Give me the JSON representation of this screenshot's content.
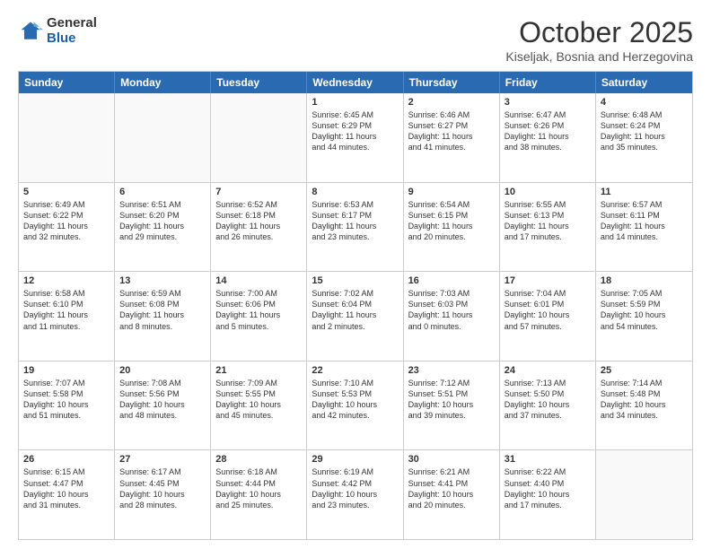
{
  "header": {
    "logo_general": "General",
    "logo_blue": "Blue",
    "month_title": "October 2025",
    "location": "Kiseljak, Bosnia and Herzegovina"
  },
  "calendar": {
    "days": [
      "Sunday",
      "Monday",
      "Tuesday",
      "Wednesday",
      "Thursday",
      "Friday",
      "Saturday"
    ],
    "rows": [
      [
        {
          "day": "",
          "info": ""
        },
        {
          "day": "",
          "info": ""
        },
        {
          "day": "",
          "info": ""
        },
        {
          "day": "1",
          "info": "Sunrise: 6:45 AM\nSunset: 6:29 PM\nDaylight: 11 hours\nand 44 minutes."
        },
        {
          "day": "2",
          "info": "Sunrise: 6:46 AM\nSunset: 6:27 PM\nDaylight: 11 hours\nand 41 minutes."
        },
        {
          "day": "3",
          "info": "Sunrise: 6:47 AM\nSunset: 6:26 PM\nDaylight: 11 hours\nand 38 minutes."
        },
        {
          "day": "4",
          "info": "Sunrise: 6:48 AM\nSunset: 6:24 PM\nDaylight: 11 hours\nand 35 minutes."
        }
      ],
      [
        {
          "day": "5",
          "info": "Sunrise: 6:49 AM\nSunset: 6:22 PM\nDaylight: 11 hours\nand 32 minutes."
        },
        {
          "day": "6",
          "info": "Sunrise: 6:51 AM\nSunset: 6:20 PM\nDaylight: 11 hours\nand 29 minutes."
        },
        {
          "day": "7",
          "info": "Sunrise: 6:52 AM\nSunset: 6:18 PM\nDaylight: 11 hours\nand 26 minutes."
        },
        {
          "day": "8",
          "info": "Sunrise: 6:53 AM\nSunset: 6:17 PM\nDaylight: 11 hours\nand 23 minutes."
        },
        {
          "day": "9",
          "info": "Sunrise: 6:54 AM\nSunset: 6:15 PM\nDaylight: 11 hours\nand 20 minutes."
        },
        {
          "day": "10",
          "info": "Sunrise: 6:55 AM\nSunset: 6:13 PM\nDaylight: 11 hours\nand 17 minutes."
        },
        {
          "day": "11",
          "info": "Sunrise: 6:57 AM\nSunset: 6:11 PM\nDaylight: 11 hours\nand 14 minutes."
        }
      ],
      [
        {
          "day": "12",
          "info": "Sunrise: 6:58 AM\nSunset: 6:10 PM\nDaylight: 11 hours\nand 11 minutes."
        },
        {
          "day": "13",
          "info": "Sunrise: 6:59 AM\nSunset: 6:08 PM\nDaylight: 11 hours\nand 8 minutes."
        },
        {
          "day": "14",
          "info": "Sunrise: 7:00 AM\nSunset: 6:06 PM\nDaylight: 11 hours\nand 5 minutes."
        },
        {
          "day": "15",
          "info": "Sunrise: 7:02 AM\nSunset: 6:04 PM\nDaylight: 11 hours\nand 2 minutes."
        },
        {
          "day": "16",
          "info": "Sunrise: 7:03 AM\nSunset: 6:03 PM\nDaylight: 11 hours\nand 0 minutes."
        },
        {
          "day": "17",
          "info": "Sunrise: 7:04 AM\nSunset: 6:01 PM\nDaylight: 10 hours\nand 57 minutes."
        },
        {
          "day": "18",
          "info": "Sunrise: 7:05 AM\nSunset: 5:59 PM\nDaylight: 10 hours\nand 54 minutes."
        }
      ],
      [
        {
          "day": "19",
          "info": "Sunrise: 7:07 AM\nSunset: 5:58 PM\nDaylight: 10 hours\nand 51 minutes."
        },
        {
          "day": "20",
          "info": "Sunrise: 7:08 AM\nSunset: 5:56 PM\nDaylight: 10 hours\nand 48 minutes."
        },
        {
          "day": "21",
          "info": "Sunrise: 7:09 AM\nSunset: 5:55 PM\nDaylight: 10 hours\nand 45 minutes."
        },
        {
          "day": "22",
          "info": "Sunrise: 7:10 AM\nSunset: 5:53 PM\nDaylight: 10 hours\nand 42 minutes."
        },
        {
          "day": "23",
          "info": "Sunrise: 7:12 AM\nSunset: 5:51 PM\nDaylight: 10 hours\nand 39 minutes."
        },
        {
          "day": "24",
          "info": "Sunrise: 7:13 AM\nSunset: 5:50 PM\nDaylight: 10 hours\nand 37 minutes."
        },
        {
          "day": "25",
          "info": "Sunrise: 7:14 AM\nSunset: 5:48 PM\nDaylight: 10 hours\nand 34 minutes."
        }
      ],
      [
        {
          "day": "26",
          "info": "Sunrise: 6:15 AM\nSunset: 4:47 PM\nDaylight: 10 hours\nand 31 minutes."
        },
        {
          "day": "27",
          "info": "Sunrise: 6:17 AM\nSunset: 4:45 PM\nDaylight: 10 hours\nand 28 minutes."
        },
        {
          "day": "28",
          "info": "Sunrise: 6:18 AM\nSunset: 4:44 PM\nDaylight: 10 hours\nand 25 minutes."
        },
        {
          "day": "29",
          "info": "Sunrise: 6:19 AM\nSunset: 4:42 PM\nDaylight: 10 hours\nand 23 minutes."
        },
        {
          "day": "30",
          "info": "Sunrise: 6:21 AM\nSunset: 4:41 PM\nDaylight: 10 hours\nand 20 minutes."
        },
        {
          "day": "31",
          "info": "Sunrise: 6:22 AM\nSunset: 4:40 PM\nDaylight: 10 hours\nand 17 minutes."
        },
        {
          "day": "",
          "info": ""
        }
      ]
    ]
  }
}
